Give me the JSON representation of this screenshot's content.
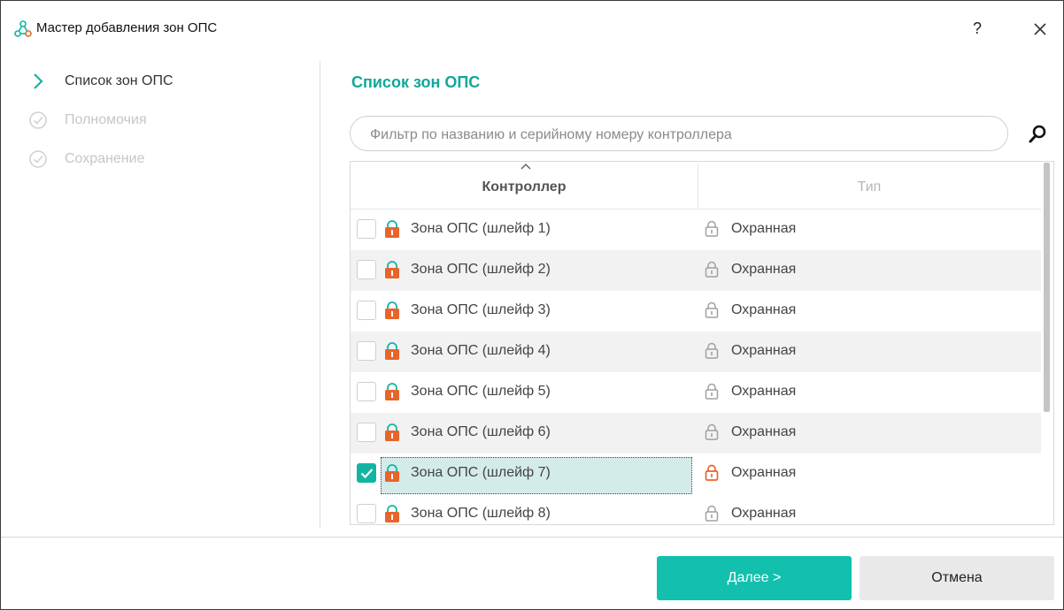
{
  "window": {
    "title": "Мастер добавления зон ОПС",
    "help_label": "?",
    "app_icon": "network-nodes-icon",
    "accent_color": "#12c0ad"
  },
  "steps": [
    {
      "label": "Список зон ОПС",
      "state": "active",
      "icon": "chevron-right-icon"
    },
    {
      "label": "Полномочия",
      "state": "inactive",
      "icon": "check-circle-icon"
    },
    {
      "label": "Сохранение",
      "state": "inactive",
      "icon": "check-circle-icon"
    }
  ],
  "main": {
    "section_title": "Список зон ОПС",
    "filter": {
      "placeholder": "Фильтр по названию и серийному номеру контроллера",
      "value": ""
    },
    "grid": {
      "columns": [
        "Контроллер",
        "Тип"
      ],
      "sort_column": "Контроллер",
      "rows": [
        {
          "name": "Зона ОПС (шлейф  1)",
          "type": "Охранная",
          "checked": false
        },
        {
          "name": "Зона ОПС (шлейф  2)",
          "type": "Охранная",
          "checked": false
        },
        {
          "name": "Зона ОПС (шлейф  3)",
          "type": "Охранная",
          "checked": false
        },
        {
          "name": "Зона ОПС (шлейф  4)",
          "type": "Охранная",
          "checked": false
        },
        {
          "name": "Зона ОПС (шлейф  5)",
          "type": "Охранная",
          "checked": false
        },
        {
          "name": "Зона ОПС (шлейф  6)",
          "type": "Охранная",
          "checked": false
        },
        {
          "name": "Зона ОПС (шлейф  7)",
          "type": "Охранная",
          "checked": true
        },
        {
          "name": "Зона ОПС (шлейф  8)",
          "type": "Охранная",
          "checked": false
        }
      ]
    }
  },
  "footer": {
    "next_label_underlined": "Д",
    "next_label_rest": "алее >",
    "cancel_label": "Отмена"
  }
}
